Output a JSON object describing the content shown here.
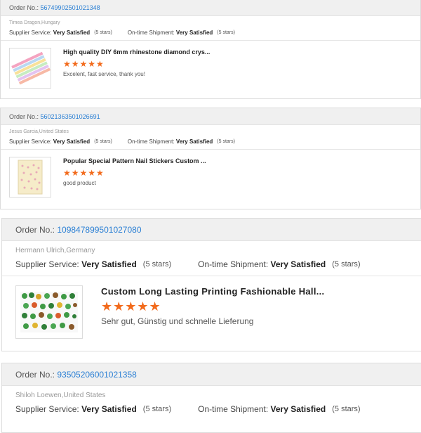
{
  "labels": {
    "order_no": "Order No.:",
    "supplier_service": "Supplier Service:",
    "ontime_shipment": "On-time Shipment:"
  },
  "colors": {
    "stars": "#f26a1b",
    "link": "#2a7fd4"
  },
  "orders": [
    {
      "order_number": "56749902501021348",
      "reviewer": "Timea Dragon,Hungary",
      "supplier_rating": "Very Satisfied",
      "supplier_stars": "(5 stars)",
      "shipment_rating": "Very Satisfied",
      "shipment_stars": "(5 stars)",
      "product_title": "High quality DIY 6mm rhinestone diamond crys...",
      "stars": "★★★★★",
      "rating": 5,
      "comment": "Excelent, fast service, thank you!"
    },
    {
      "order_number": "56021363501026691",
      "reviewer": "Jesus Garcia,United States",
      "supplier_rating": "Very Satisfied",
      "supplier_stars": "(5 stars)",
      "shipment_rating": "Very Satisfied",
      "shipment_stars": "(5 stars)",
      "product_title": "Popular Special Pattern Nail Stickers Custom ...",
      "stars": "★★★★★",
      "rating": 5,
      "comment": "good product"
    },
    {
      "order_number": "109847899501027080",
      "reviewer": "Hermann Ulrich,Germany",
      "supplier_rating": "Very Satisfied",
      "supplier_stars": "(5 stars)",
      "shipment_rating": "Very Satisfied",
      "shipment_stars": "(5 stars)",
      "product_title": "Custom Long Lasting Printing Fashionable Hall...",
      "stars": "★★★★★",
      "rating": 5,
      "comment": "Sehr gut, Günstig und schnelle Lieferung"
    },
    {
      "order_number": "93505206001021358",
      "reviewer": "Shiloh Loewen,United States",
      "supplier_rating": "Very Satisfied",
      "supplier_stars": "(5 stars)",
      "shipment_rating": "Very Satisfied",
      "shipment_stars": "(5 stars)"
    }
  ]
}
